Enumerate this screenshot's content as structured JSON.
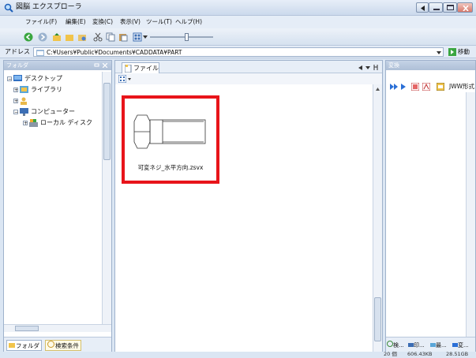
{
  "window": {
    "title": "図脳 エクスプローラ"
  },
  "menu": [
    "ファイル(F)",
    "編集(E)",
    "変換(C)",
    "表示(V)",
    "ツール(T)",
    "ヘルプ(H)"
  ],
  "address": {
    "label": "アドレス",
    "path": "C:¥Users¥Public¥Documents¥CADDATA¥PART",
    "move_label": "移動"
  },
  "left_pane": {
    "header": "フォルダ",
    "tree": [
      "デスクトップ",
      "ライブラリ",
      "コンピューター",
      "ローカル ディスク"
    ],
    "tabs": [
      "フォルダ",
      "検索条件"
    ]
  },
  "center_pane": {
    "tab_label": "ファイル",
    "file": {
      "name": "可変ネジ_水平方向.zsvx"
    }
  },
  "right_pane": {
    "header": "変換",
    "jww_label": "JWW形式",
    "tabs": [
      "検...",
      "印...",
      "最...",
      "変..."
    ]
  },
  "status": {
    "count": "20 個",
    "size": "606.43KB",
    "disk": "28.51GB"
  },
  "colors": {
    "highlight_border": "#e8141a",
    "accent": "#2a6fd6"
  }
}
